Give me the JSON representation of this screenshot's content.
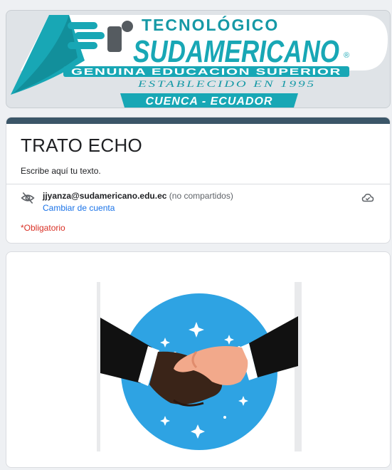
{
  "banner": {
    "top_line": "TECNOLÓGICO",
    "brand": "SUDAMERICANO",
    "registered": "®",
    "tagline": "GENUINA EDUCACION SUPERIOR",
    "established": "ESTABLECIDO EN 1995",
    "location": "CUENCA - ECUADOR",
    "colors": {
      "teal": "#18a7b5",
      "teal_dark": "#0f7f8a"
    }
  },
  "form": {
    "title": "TRATO ECHO",
    "description": "Escribe aquí tu texto.",
    "account_email": "jjyanza@sudamericano.edu.ec",
    "account_note": "(no compartidos)",
    "switch_account": "Cambiar de cuenta",
    "required_note": "*Obligatorio",
    "accent_color": "#3b5668"
  },
  "icons": {
    "privacy": "eye-off-icon",
    "cloud": "cloud-check-icon",
    "handshake": "handshake-illustration"
  }
}
